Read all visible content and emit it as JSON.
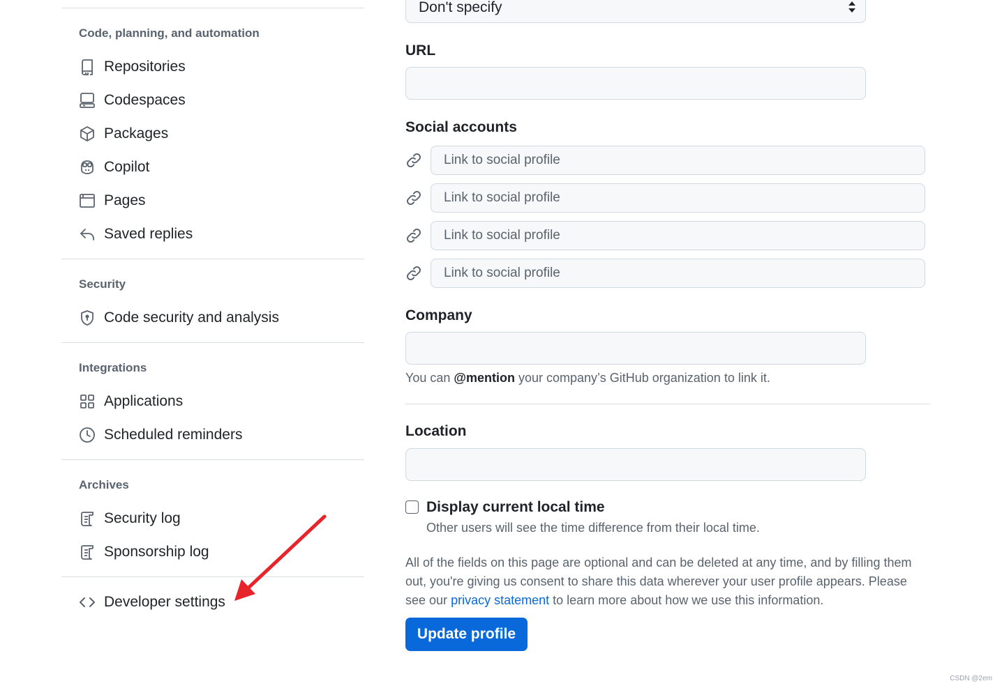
{
  "sidebar": {
    "groups": [
      {
        "heading": "Code, planning, and automation",
        "items": [
          {
            "label": "Repositories",
            "icon": "repo-icon"
          },
          {
            "label": "Codespaces",
            "icon": "codespaces-icon"
          },
          {
            "label": "Packages",
            "icon": "package-icon"
          },
          {
            "label": "Copilot",
            "icon": "copilot-icon"
          },
          {
            "label": "Pages",
            "icon": "browser-icon"
          },
          {
            "label": "Saved replies",
            "icon": "reply-icon"
          }
        ]
      },
      {
        "heading": "Security",
        "items": [
          {
            "label": "Code security and analysis",
            "icon": "shield-icon"
          }
        ]
      },
      {
        "heading": "Integrations",
        "items": [
          {
            "label": "Applications",
            "icon": "apps-icon"
          },
          {
            "label": "Scheduled reminders",
            "icon": "clock-icon"
          }
        ]
      },
      {
        "heading": "Archives",
        "items": [
          {
            "label": "Security log",
            "icon": "log-icon"
          },
          {
            "label": "Sponsorship log",
            "icon": "log-icon"
          }
        ]
      }
    ],
    "developer_settings": {
      "label": "Developer settings",
      "icon": "code-icon"
    }
  },
  "form": {
    "pronouns_select": {
      "value": "Don't specify"
    },
    "url": {
      "label": "URL",
      "value": ""
    },
    "social": {
      "label": "Social accounts",
      "placeholder": "Link to social profile"
    },
    "company": {
      "label": "Company",
      "value": "",
      "hint_prefix": "You can",
      "hint_mention": "@mention",
      "hint_suffix": "your company’s GitHub organization to link it."
    },
    "location": {
      "label": "Location",
      "value": ""
    },
    "local_time": {
      "label": "Display current local time",
      "hint": "Other users will see the time difference from their local time.",
      "checked": false
    },
    "notice": {
      "prefix": "All of the fields on this page are optional and can be deleted at any time, and by filling them out, you're giving us consent to share this data wherever your user profile appears. Please see our",
      "link": "privacy statement",
      "suffix": "to learn more about how we use this information."
    },
    "submit_label": "Update profile"
  },
  "annotation": {
    "arrow_color": "#e8242b"
  },
  "watermark": "CSDN @2em",
  "colors": {
    "accent": "#0969da",
    "muted": "#59636e",
    "border": "#d1d9e0",
    "input_bg": "#f6f8fa"
  }
}
